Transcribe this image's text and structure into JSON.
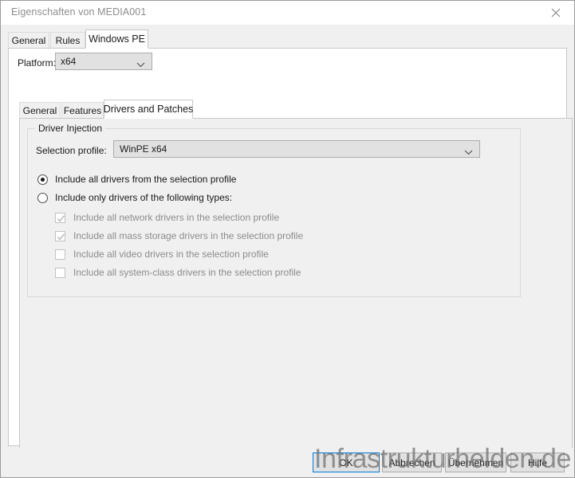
{
  "window": {
    "title": "Eigenschaften von MEDIA001",
    "close_icon": "close-icon"
  },
  "outer_tabs": [
    {
      "label": "General",
      "selected": false
    },
    {
      "label": "Rules",
      "selected": false
    },
    {
      "label": "Windows PE",
      "selected": true
    }
  ],
  "platform": {
    "label": "Platform:",
    "value": "x64",
    "arrow_icon": "chevron-down-icon"
  },
  "inner_tabs": [
    {
      "label": "General",
      "selected": false
    },
    {
      "label": "Features",
      "selected": false
    },
    {
      "label": "Drivers and Patches",
      "selected": true
    }
  ],
  "driver_injection": {
    "group_label": "Driver Injection",
    "profile_label": "Selection profile:",
    "profile_value": "WinPE x64",
    "profile_arrow_icon": "chevron-down-icon",
    "radios": [
      {
        "label": "Include all drivers from the selection profile",
        "checked": true
      },
      {
        "label": "Include only drivers of the following types:",
        "checked": false
      }
    ],
    "checkboxes": [
      {
        "label": "Include all network drivers in the selection profile",
        "checked": true,
        "disabled": true
      },
      {
        "label": "Include all mass storage drivers in the selection profile",
        "checked": true,
        "disabled": true
      },
      {
        "label": "Include all video drivers in the selection profile",
        "checked": false,
        "disabled": true
      },
      {
        "label": "Include all system-class drivers in the selection profile",
        "checked": false,
        "disabled": true
      }
    ]
  },
  "buttons": {
    "ok": "OK",
    "cancel": "Abbrechen",
    "apply": "Übernehmen",
    "help": "Hilfe"
  },
  "watermark": {
    "text": "Infrastrukturhelden.de"
  },
  "colors": {
    "accent": "#0078d7",
    "control_face": "#f0f0f0",
    "field_face": "#e1e1e1",
    "disabled_text": "#8c8c8c",
    "title_text": "#8d8d8d"
  }
}
